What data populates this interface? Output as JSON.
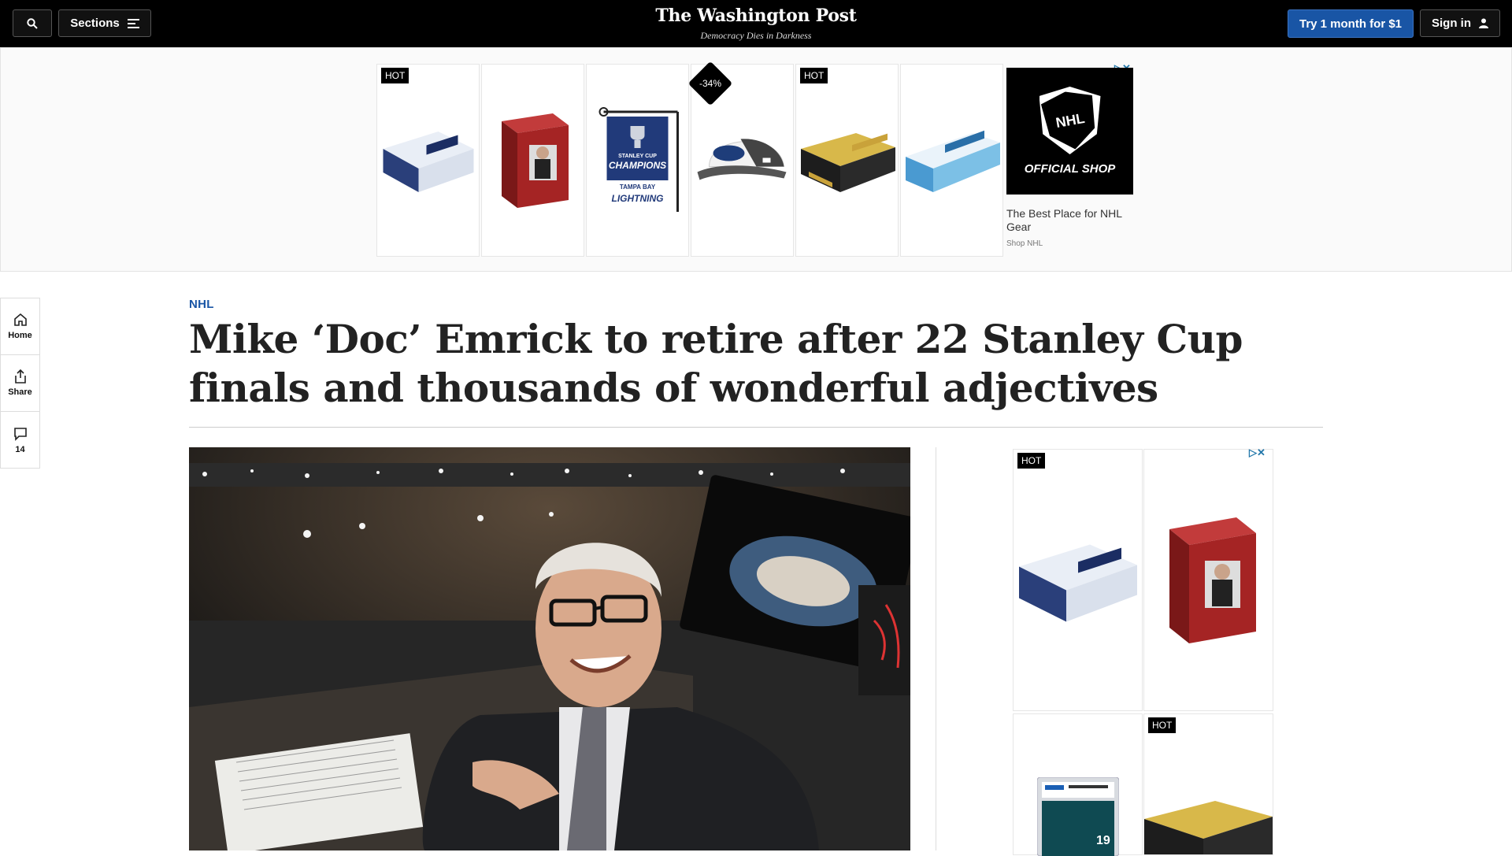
{
  "nav": {
    "sections_label": "Sections",
    "logo": "The Washington Post",
    "tagline": "Democracy Dies in Darkness",
    "subscribe_label": "Try 1 month for $1",
    "signin_label": "Sign in"
  },
  "top_ad": {
    "badges": [
      "HOT",
      "-34%",
      "HOT"
    ],
    "brand_mark": "NHL",
    "brand_text": "OFFICIAL SHOP",
    "title": "The Best Place for NHL Gear",
    "sponsor": "Shop NHL",
    "pennant": {
      "line1": "STANLEY CUP",
      "line2": "CHAMPIONS",
      "line3": "TAMPA BAY",
      "line4": "LIGHTNING"
    }
  },
  "rail": {
    "home_label": "Home",
    "share_label": "Share",
    "comments_count": "14"
  },
  "article": {
    "kicker": "NHL",
    "headline": "Mike ‘Doc’ Emrick to retire after 22 Stanley Cup finals and thousands of wonderful adjectives"
  },
  "right_ad": {
    "badges": [
      "HOT",
      "HOT"
    ],
    "slab_number": "19"
  },
  "colors": {
    "accent": "#1955a5",
    "nav_bg": "#000000"
  }
}
